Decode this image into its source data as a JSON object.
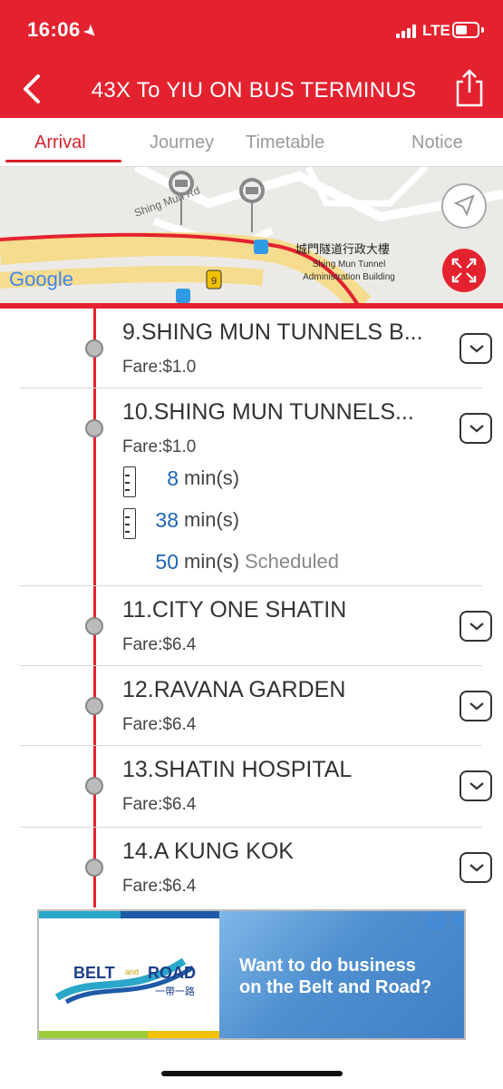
{
  "status_bar": {
    "time": "16:06",
    "network": "LTE"
  },
  "header": {
    "title": "43X To YIU ON BUS TERMINUS",
    "back_icon": "chevron-left-icon",
    "share_icon": "share-icon"
  },
  "tabs": [
    {
      "label": "Arrival",
      "active": true
    },
    {
      "label": "Journey",
      "active": false
    },
    {
      "label": "Timetable",
      "active": false
    },
    {
      "label": "Notice",
      "active": false
    }
  ],
  "map": {
    "road_label": "Shing Mun Rd",
    "building_label_zh": "城門隧道行政大樓",
    "building_label_en_1": "Shing Mun Tunnel",
    "building_label_en_2": "Administration Building",
    "route_shield": "9",
    "provider": "Google"
  },
  "stops": [
    {
      "name": "9.SHING MUN TUNNELS B...",
      "fare": "Fare:$1.0"
    },
    {
      "name": "10.SHING MUN TUNNELS...",
      "fare": "Fare:$1.0",
      "etas": [
        {
          "minutes": "8",
          "unit": "min(s)",
          "note": ""
        },
        {
          "minutes": "38",
          "unit": "min(s)",
          "note": ""
        },
        {
          "minutes": "50",
          "unit": "min(s)",
          "note": "Scheduled"
        }
      ]
    },
    {
      "name": "11.CITY ONE SHATIN",
      "fare": "Fare:$6.4"
    },
    {
      "name": "12.RAVANA GARDEN",
      "fare": "Fare:$6.4"
    },
    {
      "name": "13.SHATIN HOSPITAL",
      "fare": "Fare:$6.4"
    },
    {
      "name": "14.A KUNG KOK",
      "fare": "Fare:$6.4"
    }
  ],
  "ad": {
    "logo_text_1": "BELT",
    "logo_text_and": "and",
    "logo_text_2": "ROAD",
    "logo_text_zh": "一帶一路",
    "tagline_1": "Want to do business",
    "tagline_2": "on the Belt and Road?",
    "info_glyph": "i",
    "close_glyph": "✕"
  },
  "colors": {
    "brand_red": "#e4222f",
    "eta_blue": "#1c66b5"
  }
}
